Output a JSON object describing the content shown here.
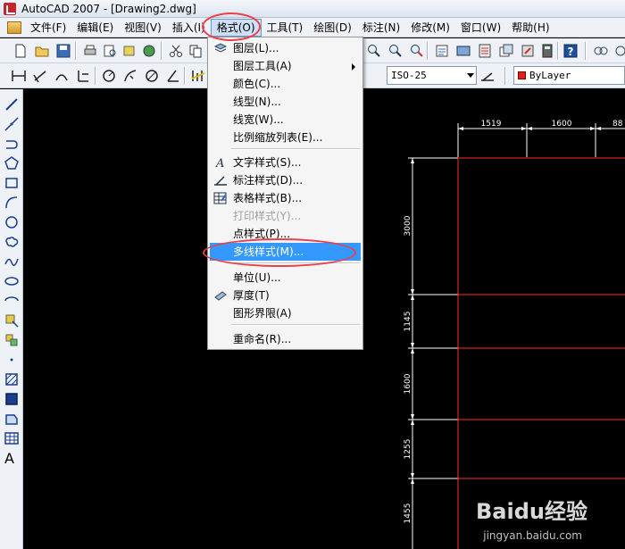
{
  "window": {
    "title": "AutoCAD 2007 - [Drawing2.dwg]"
  },
  "menubar": [
    {
      "label": "文件(F)"
    },
    {
      "label": "编辑(E)"
    },
    {
      "label": "视图(V)"
    },
    {
      "label": "插入(I)"
    },
    {
      "label": "格式(O)"
    },
    {
      "label": "工具(T)"
    },
    {
      "label": "绘图(D)"
    },
    {
      "label": "标注(N)"
    },
    {
      "label": "修改(M)"
    },
    {
      "label": "窗口(W)"
    },
    {
      "label": "帮助(H)"
    }
  ],
  "toolbar": {
    "dimstyle_combo": "ISO-25",
    "color_combo": "ByLayer",
    "color_swatch": "#e02020"
  },
  "format_menu": {
    "items": [
      {
        "label": "图层(L)...",
        "icon": "layers-icon"
      },
      {
        "label": "图层工具(A)",
        "submenu": true
      },
      {
        "label": "颜色(C)..."
      },
      {
        "label": "线型(N)..."
      },
      {
        "label": "线宽(W)..."
      },
      {
        "label": "比例缩放列表(E)..."
      },
      {
        "label": "文字样式(S)...",
        "icon": "text-style-icon"
      },
      {
        "label": "标注样式(D)...",
        "icon": "dim-style-icon"
      },
      {
        "label": "表格样式(B)...",
        "icon": "table-style-icon"
      },
      {
        "label": "打印样式(Y)...",
        "disabled": true
      },
      {
        "label": "点样式(P)..."
      },
      {
        "label": "多线样式(M)...",
        "highlighted": true
      },
      {
        "label": "单位(U)..."
      },
      {
        "label": "厚度(T)",
        "icon": "thickness-icon"
      },
      {
        "label": "图形界限(A)"
      },
      {
        "label": "重命名(R)..."
      }
    ]
  },
  "drawing": {
    "top_dims": [
      "1519",
      "1600",
      "88"
    ],
    "left_dims": [
      "3000",
      "1145",
      "1600",
      "1255",
      "1455"
    ]
  },
  "watermark": {
    "brand": "Baidu经验",
    "url": "jingyan.baidu.com"
  }
}
